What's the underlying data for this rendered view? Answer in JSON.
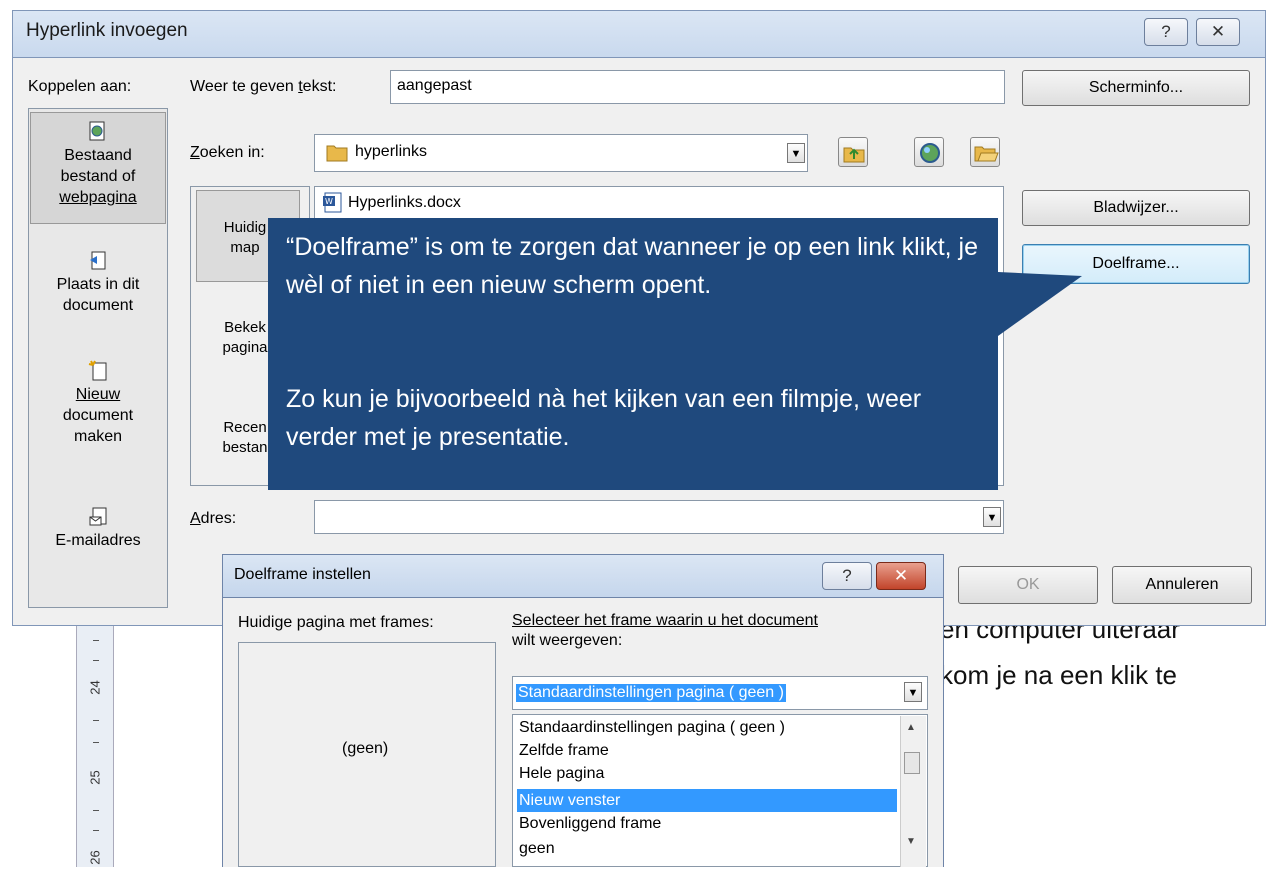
{
  "main_dialog": {
    "title": "Hyperlink invoegen",
    "help_btn": "?",
    "close_btn": "✕",
    "link_to_label": "Koppelen aan:",
    "display_text_label_pre": "Weer te geven ",
    "display_text_label_u": "t",
    "display_text_label_post": "ekst:",
    "display_text_value": "aangepast",
    "screentip_button": "Scherminfo...",
    "look_in_label_u": "Z",
    "look_in_label_post": "oeken in:",
    "look_in_value": "hyperlinks",
    "file_item": "Hyperlinks.docx",
    "address_label_u": "A",
    "address_label_post": "dres:",
    "address_value": "",
    "bookmark_button": "Bladwijzer...",
    "target_frame_button": "Doelframe...",
    "ok_button": "OK",
    "cancel_button": "Annuleren",
    "left_items": [
      {
        "line1": "Bestaand",
        "line2": "bestand of",
        "line3": "webpagina"
      },
      {
        "line1": "Plaats in dit",
        "line2": "document"
      },
      {
        "line1": "Nieuw",
        "line2": "document",
        "line3": "maken"
      },
      {
        "line1": "E-mailadres"
      }
    ],
    "side_buttons": [
      {
        "line1": "Huidig",
        "line2": "map"
      },
      {
        "line1": "Bekek",
        "line2": "pagina"
      },
      {
        "line1": "Recen",
        "line2": "bestan"
      }
    ]
  },
  "callout": {
    "paragraph1": "“Doelframe” is om te zorgen dat wanneer je op een link klikt, je wèl of niet in een nieuw scherm opent.",
    "paragraph2": "Zo kun je bijvoorbeeld nà het kijken van een filmpje, weer verder met je presentatie."
  },
  "frame_dialog": {
    "title": "Doelframe instellen",
    "help_btn": "?",
    "close_btn": "✕",
    "current_page_label": "Huidige pagina met frames:",
    "frame_preview_text": "(geen)",
    "select_label_line1": "Selecteer het frame waarin u het document",
    "select_label_line2": "wilt weergeven:",
    "selected_value": "Standaardinstellingen pagina ( geen )",
    "options": [
      "Standaardinstellingen pagina ( geen )",
      "Zelfde frame",
      "Hele pagina",
      "Nieuw venster",
      "Bovenliggend frame",
      "geen"
    ],
    "highlighted_option": "Nieuw venster"
  },
  "background_doc": {
    "line1": "en computer uiteraar",
    "line2": "kom je na een klik te",
    "ruler_24": "24",
    "ruler_25": "25",
    "ruler_26": "26"
  }
}
